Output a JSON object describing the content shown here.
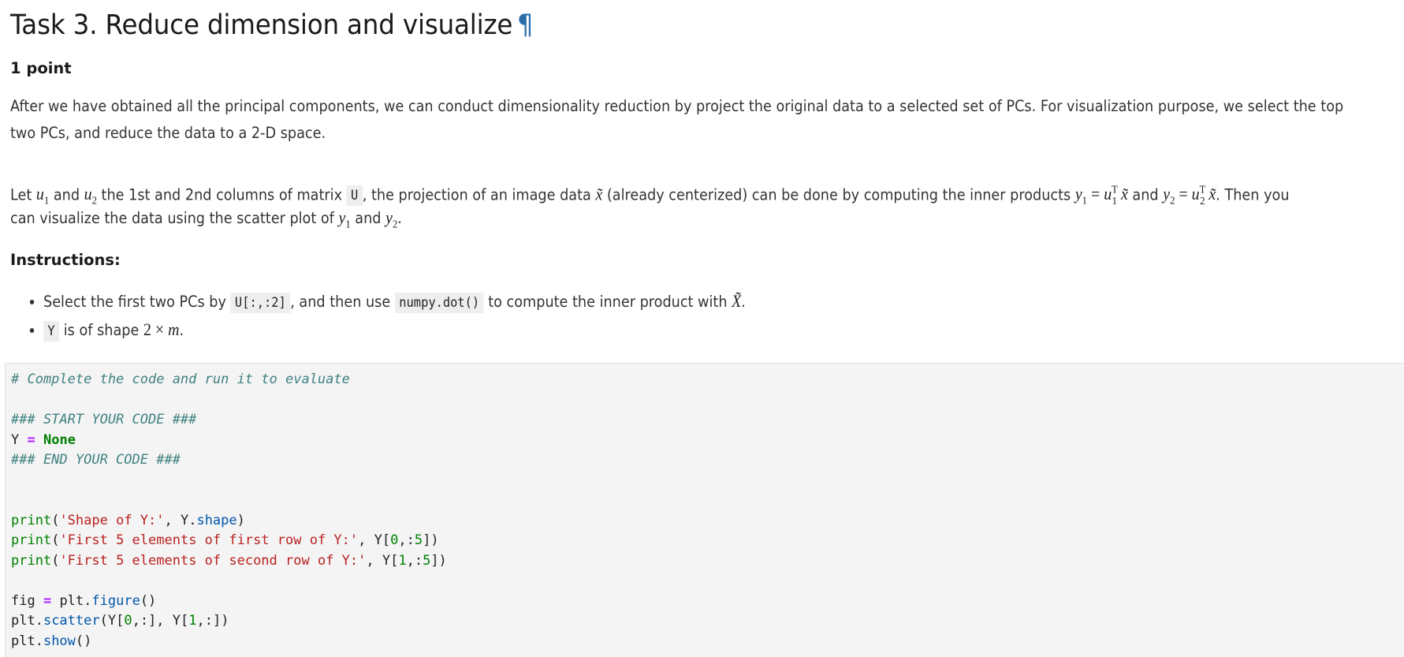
{
  "heading": {
    "title": "Task 3. Reduce dimension and visualize",
    "anchor_symbol": "¶"
  },
  "points_label": "1 point",
  "paragraph1": {
    "line1": "After we have obtained all the principal components, we can conduct dimensionality reduction by project the original data to a selected set of PCs. For visualization purpose, we select the top",
    "line2": "two PCs, and reduce the data to a 2-D space."
  },
  "paragraph2": {
    "t1": "Let ",
    "u1": "u",
    "u1_sub": "1",
    "t2": " and ",
    "u2": "u",
    "u2_sub": "2",
    "t3": " the 1st and 2nd columns of matrix ",
    "matrix_code": "U",
    "t4": ", the projection of an image data ",
    "xtilde": "x̃",
    "t5": " (already centerized) can be done by computing the inner products ",
    "eq1_lhs": "y",
    "eq1_lhs_sub": "1",
    "eq1_rhs": "u",
    "eq1_rhs_sup": "T",
    "eq1_rhs_sub": "1",
    "t6": " and ",
    "eq2_lhs": "y",
    "eq2_lhs_sub": "2",
    "eq2_rhs": "u",
    "eq2_rhs_sup": "T",
    "eq2_rhs_sub": "2",
    "t7": ". Then you",
    "line2_t1": "can visualize the data using the scatter plot of ",
    "y1": "y",
    "y1_sub": "1",
    "line2_t2": " and ",
    "y2": "y",
    "y2_sub": "2",
    "line2_t3": "."
  },
  "instructions": {
    "label": "Instructions:",
    "items": [
      {
        "t1": "Select the first two PCs by ",
        "code1": "U[:,:2]",
        "t2": ", and then use ",
        "code2": "numpy.dot()",
        "t3": " to compute the inner product with ",
        "math": "X̃",
        "t4": "."
      },
      {
        "code": "Y",
        "t1": " is of shape ",
        "math": "2 × ",
        "math_var": "m",
        "t2": "."
      }
    ]
  },
  "code_cell": {
    "lines": {
      "comment1": "# Complete the code and run it to evaluate",
      "start": "### START YOUR CODE ###",
      "assign_var": "Y",
      "assign_op": "=",
      "assign_val": "None",
      "end": "### END YOUR CODE ###",
      "print1_fn": "print",
      "print1_str": "'Shape of Y:'",
      "print1_rest_a": ", Y.",
      "print1_attr": "shape",
      "print1_rest_b": ")",
      "print2_fn": "print",
      "print2_str": "'First 5 elements of first row of Y:'",
      "print2_rest_a": ", Y[",
      "print2_num": "0",
      "print2_rest_b": ",:",
      "print2_num2": "5",
      "print2_rest_c": "])",
      "print3_fn": "print",
      "print3_str": "'First 5 elements of second row of Y:'",
      "print3_rest_a": ", Y[",
      "print3_num": "1",
      "print3_rest_b": ",:",
      "print3_num2": "5",
      "print3_rest_c": "])",
      "fig_var": "fig ",
      "fig_op": "=",
      "fig_rest": " plt.",
      "fig_fn": "figure",
      "fig_end": "()",
      "scatter_a": "plt.",
      "scatter_fn": "scatter",
      "scatter_b": "(Y[",
      "scatter_n0": "0",
      "scatter_c": ",:], Y[",
      "scatter_n1": "1",
      "scatter_d": ",:])",
      "show_a": "plt.",
      "show_fn": "show",
      "show_b": "()"
    }
  }
}
